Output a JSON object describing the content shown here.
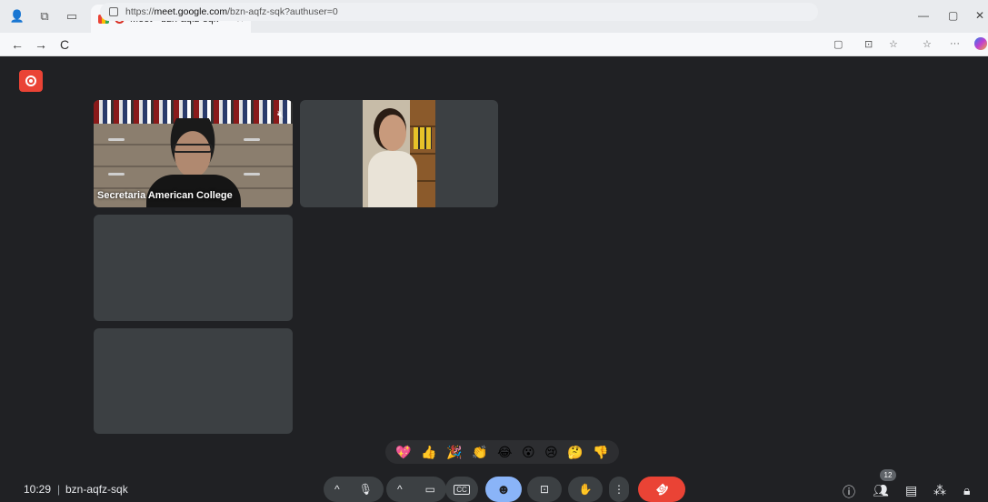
{
  "browser": {
    "tab_title": "Meet - bzn-aqfz-sqk",
    "tab_close": "×",
    "new_tab": "+",
    "url_prefix": "https://",
    "url_host": "meet.google.com",
    "url_path": "/bzn-aqfz-sqk?authuser=0",
    "minimize": "—",
    "maximize": "▢",
    "close": "✕",
    "back": "←",
    "forward": "→",
    "reload": "C",
    "menu": "···"
  },
  "meeting": {
    "time": "10:29",
    "separator": "|",
    "code": "bzn-aqfz-sqk",
    "participants_count": "12"
  },
  "participants": [
    {
      "name": "Secretaria American College",
      "muted": true
    },
    {
      "name": "",
      "muted": false
    }
  ],
  "reactions": [
    "💖",
    "👍",
    "🎉",
    "👏",
    "😂",
    "😮",
    "😢",
    "🤔",
    "👎"
  ],
  "controls": {
    "caret": "^",
    "mic": "🎙",
    "camera": "▭",
    "captions": "CC",
    "emoji": "☻",
    "present": "⊡",
    "raise_hand": "✋",
    "more": "⋮",
    "end_call": "☎"
  },
  "colors": {
    "end_call": "#ea4335",
    "active_control": "#8ab4f8",
    "recording": "#ea4335"
  }
}
